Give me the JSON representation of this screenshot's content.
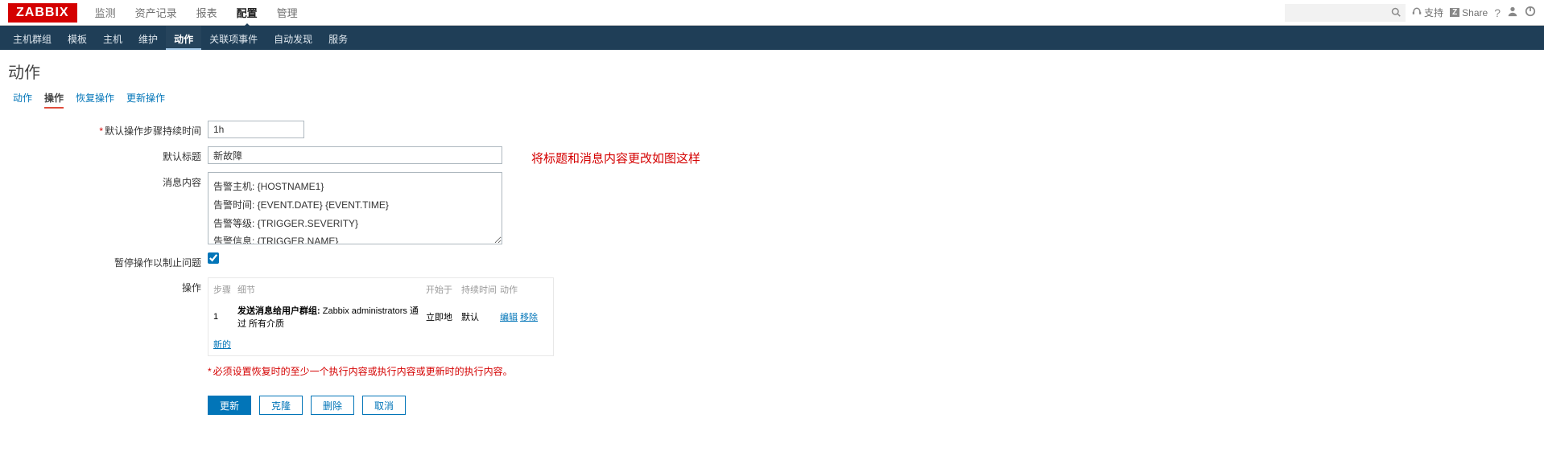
{
  "logo": "ZABBIX",
  "topnav": {
    "items": [
      "监测",
      "资产记录",
      "报表",
      "配置",
      "管理"
    ],
    "activeIndex": 3
  },
  "topright": {
    "search_placeholder": "",
    "support": "支持",
    "share": "Share",
    "share_badge": "Z"
  },
  "subnav": {
    "items": [
      "主机群组",
      "模板",
      "主机",
      "维护",
      "动作",
      "关联项事件",
      "自动发现",
      "服务"
    ],
    "activeIndex": 4
  },
  "page_title": "动作",
  "tabs": {
    "items": [
      "动作",
      "操作",
      "恢复操作",
      "更新操作"
    ],
    "activeIndex": 1
  },
  "form": {
    "duration_label": "默认操作步骤持续时间",
    "duration_value": "1h",
    "title_label": "默认标题",
    "title_value": "新故障",
    "message_label": "消息内容",
    "message_value": "告警主机: {HOSTNAME1}\n告警时间: {EVENT.DATE} {EVENT.TIME}\n告警等级: {TRIGGER.SEVERITY}\n告警信息: {TRIGGER.NAME}",
    "pause_label": "暂停操作以制止问题",
    "pause_checked": true,
    "ops_label": "操作",
    "ops_head": {
      "step": "步骤",
      "detail": "细节",
      "start": "开始于",
      "duration": "持续时间",
      "action": "动作"
    },
    "ops_row1": {
      "step": "1",
      "detail_bold": "发送消息给用户群组:",
      "detail_rest": " Zabbix administrators 通过 所有介质",
      "start": "立即地",
      "duration": "默认",
      "edit": "编辑",
      "remove": "移除"
    },
    "ops_new": "新的",
    "required_note": "必须设置恢复时的至少一个执行内容或执行内容或更新时的执行内容。"
  },
  "buttons": {
    "update": "更新",
    "clone": "克隆",
    "delete": "删除",
    "cancel": "取消"
  },
  "annotation": "将标题和消息内容更改如图这样"
}
